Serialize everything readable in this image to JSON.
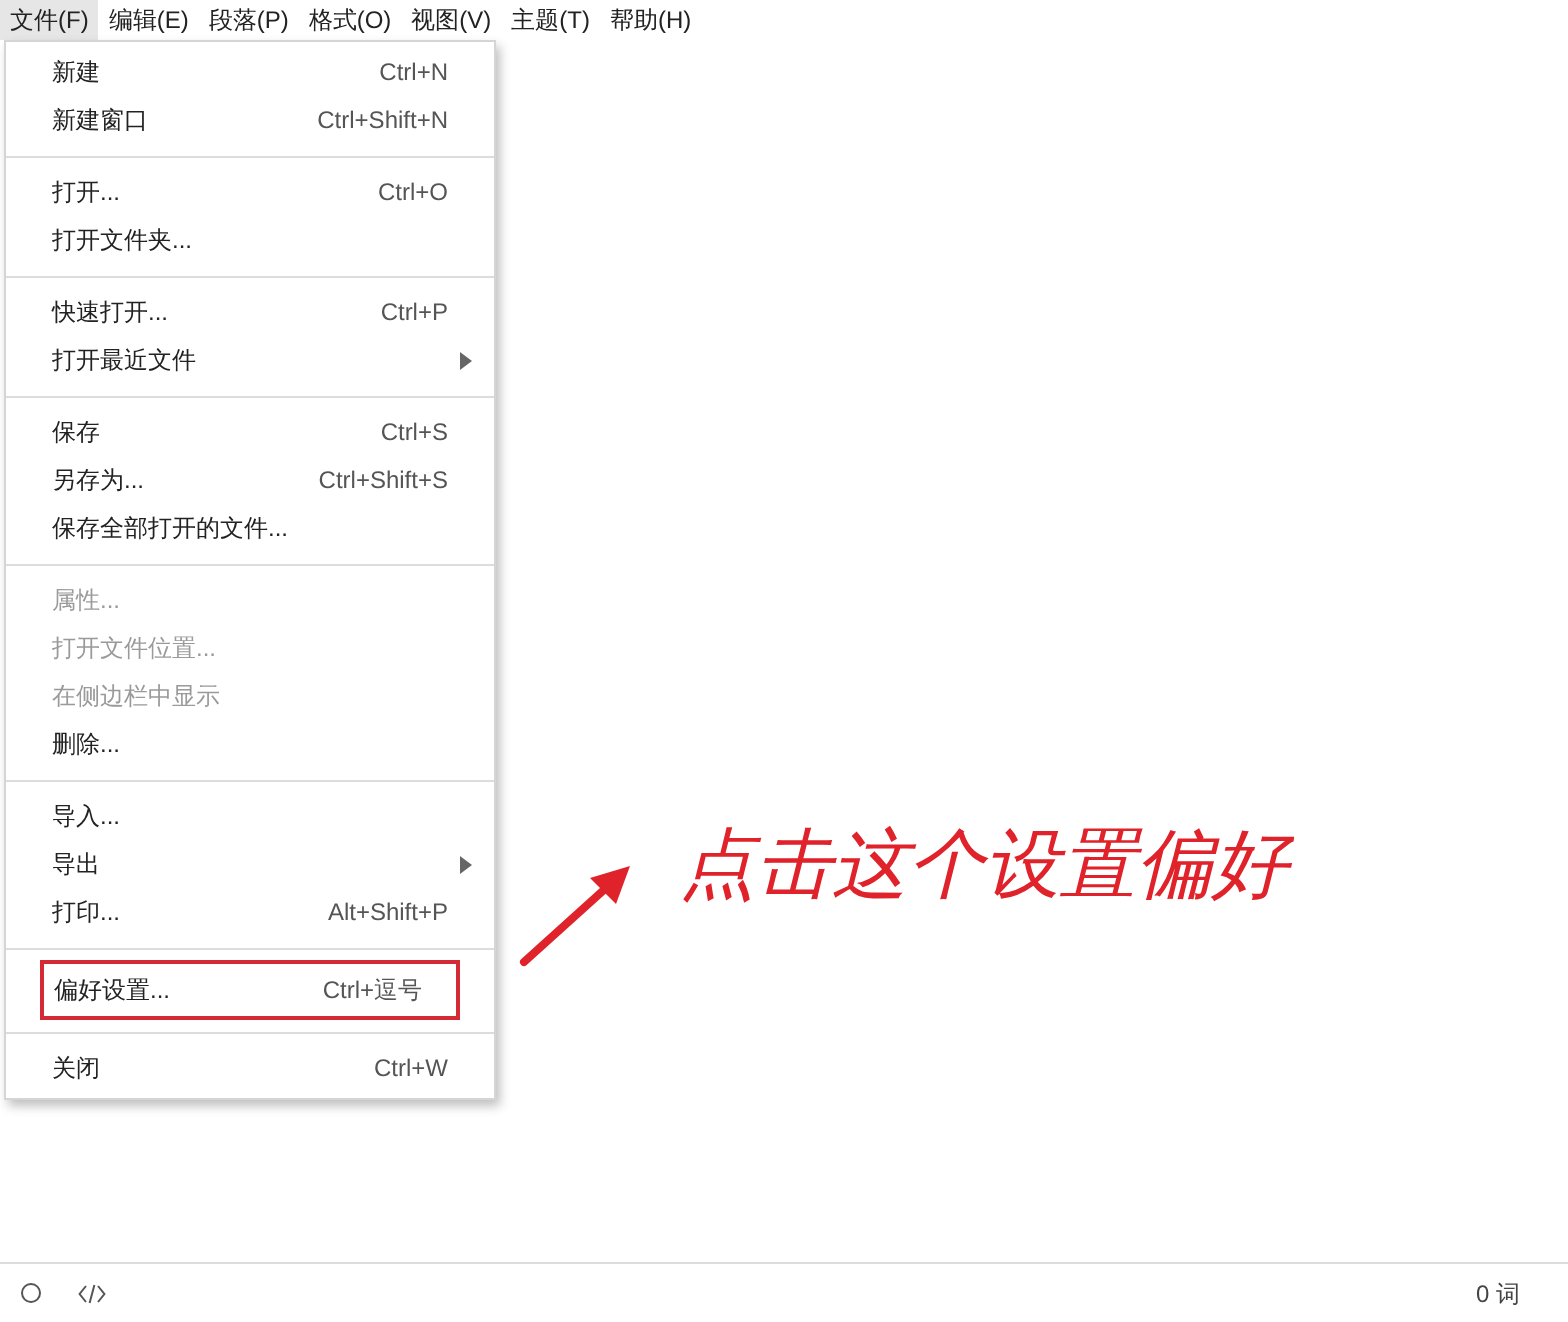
{
  "menubar": [
    {
      "label": "文件(F)",
      "selected": true
    },
    {
      "label": "编辑(E)",
      "selected": false
    },
    {
      "label": "段落(P)",
      "selected": false
    },
    {
      "label": "格式(O)",
      "selected": false
    },
    {
      "label": "视图(V)",
      "selected": false
    },
    {
      "label": "主题(T)",
      "selected": false
    },
    {
      "label": "帮助(H)",
      "selected": false
    }
  ],
  "file_menu": {
    "groups": [
      {
        "items": [
          {
            "label": "新建",
            "shortcut": "Ctrl+N",
            "disabled": false,
            "submenu": false,
            "highlighted": false
          },
          {
            "label": "新建窗口",
            "shortcut": "Ctrl+Shift+N",
            "disabled": false,
            "submenu": false,
            "highlighted": false
          }
        ]
      },
      {
        "items": [
          {
            "label": "打开...",
            "shortcut": "Ctrl+O",
            "disabled": false,
            "submenu": false,
            "highlighted": false
          },
          {
            "label": "打开文件夹...",
            "disabled": false,
            "submenu": false,
            "highlighted": false
          }
        ]
      },
      {
        "items": [
          {
            "label": "快速打开...",
            "shortcut": "Ctrl+P",
            "disabled": false,
            "submenu": false,
            "highlighted": false
          },
          {
            "label": "打开最近文件",
            "disabled": false,
            "submenu": true,
            "highlighted": false
          }
        ]
      },
      {
        "items": [
          {
            "label": "保存",
            "shortcut": "Ctrl+S",
            "disabled": false,
            "submenu": false,
            "highlighted": false
          },
          {
            "label": "另存为...",
            "shortcut": "Ctrl+Shift+S",
            "disabled": false,
            "submenu": false,
            "highlighted": false
          },
          {
            "label": "保存全部打开的文件...",
            "disabled": false,
            "submenu": false,
            "highlighted": false
          }
        ]
      },
      {
        "items": [
          {
            "label": "属性...",
            "disabled": true,
            "submenu": false,
            "highlighted": false
          },
          {
            "label": "打开文件位置...",
            "disabled": true,
            "submenu": false,
            "highlighted": false
          },
          {
            "label": "在侧边栏中显示",
            "disabled": true,
            "submenu": false,
            "highlighted": false
          },
          {
            "label": "删除...",
            "disabled": false,
            "submenu": false,
            "highlighted": false
          }
        ]
      },
      {
        "items": [
          {
            "label": "导入...",
            "disabled": false,
            "submenu": false,
            "highlighted": false
          },
          {
            "label": "导出",
            "disabled": false,
            "submenu": true,
            "highlighted": false
          },
          {
            "label": "打印...",
            "shortcut": "Alt+Shift+P",
            "disabled": false,
            "submenu": false,
            "highlighted": false
          }
        ]
      },
      {
        "items": [
          {
            "label": "偏好设置...",
            "shortcut": "Ctrl+逗号",
            "disabled": false,
            "submenu": false,
            "highlighted": true
          }
        ]
      },
      {
        "items": [
          {
            "label": "关闭",
            "shortcut": "Ctrl+W",
            "disabled": false,
            "submenu": false,
            "highlighted": false
          }
        ]
      }
    ]
  },
  "annotation": {
    "text": "点击这个设置偏好"
  },
  "status_bar": {
    "word_count": "0 词"
  }
}
